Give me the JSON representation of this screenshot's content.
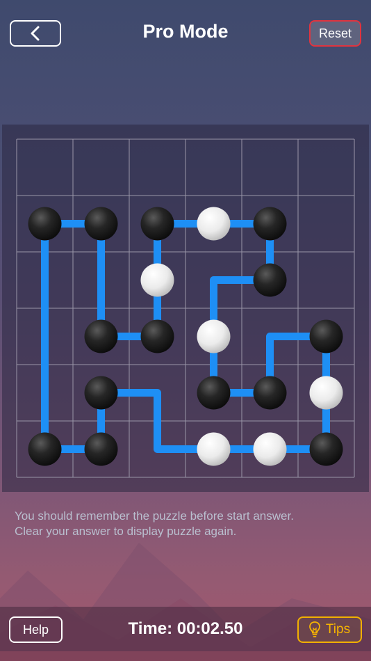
{
  "header": {
    "back_label": "",
    "title": "Pro Mode",
    "reset_label": "Reset"
  },
  "board": {
    "cols": 6,
    "rows": 6,
    "grid_line_color": "#9a96a8",
    "path_color": "#1e8ff5",
    "black_stone_color": "#1a1a1a",
    "white_stone_color": "#f2f2f2",
    "stones": [
      {
        "col": 0,
        "row": 1,
        "color": "black"
      },
      {
        "col": 1,
        "row": 1,
        "color": "black"
      },
      {
        "col": 2,
        "row": 1,
        "color": "black"
      },
      {
        "col": 3,
        "row": 1,
        "color": "white"
      },
      {
        "col": 4,
        "row": 1,
        "color": "black"
      },
      {
        "col": 2,
        "row": 2,
        "color": "white"
      },
      {
        "col": 4,
        "row": 2,
        "color": "black"
      },
      {
        "col": 1,
        "row": 3,
        "color": "black"
      },
      {
        "col": 2,
        "row": 3,
        "color": "black"
      },
      {
        "col": 3,
        "row": 3,
        "color": "white"
      },
      {
        "col": 5,
        "row": 3,
        "color": "black"
      },
      {
        "col": 1,
        "row": 4,
        "color": "black"
      },
      {
        "col": 3,
        "row": 4,
        "color": "black"
      },
      {
        "col": 4,
        "row": 4,
        "color": "black"
      },
      {
        "col": 5,
        "row": 4,
        "color": "white"
      },
      {
        "col": 0,
        "row": 5,
        "color": "black"
      },
      {
        "col": 1,
        "row": 5,
        "color": "black"
      },
      {
        "col": 3,
        "row": 5,
        "color": "white"
      },
      {
        "col": 4,
        "row": 5,
        "color": "white"
      },
      {
        "col": 5,
        "row": 5,
        "color": "black"
      }
    ],
    "path": [
      [
        0,
        1
      ],
      [
        1,
        1
      ],
      [
        1,
        3
      ],
      [
        2,
        3
      ],
      [
        2,
        1
      ],
      [
        4,
        1
      ],
      [
        4,
        2
      ],
      [
        3,
        2
      ],
      [
        3,
        4
      ],
      [
        4,
        4
      ],
      [
        4,
        3
      ],
      [
        5,
        3
      ],
      [
        5,
        5
      ],
      [
        2,
        5
      ],
      [
        2,
        4
      ],
      [
        1,
        4
      ],
      [
        1,
        5
      ],
      [
        0,
        5
      ],
      [
        0,
        1
      ]
    ]
  },
  "hint": {
    "line1": "You should remember the puzzle before start answer.",
    "line2": "Clear your answer to display puzzle again."
  },
  "footer": {
    "help_label": "Help",
    "timer_text": "Time: 00:02.50",
    "tips_label": "Tips"
  },
  "icons": {
    "back": "chevron-left-icon",
    "tips": "lightbulb-icon"
  }
}
